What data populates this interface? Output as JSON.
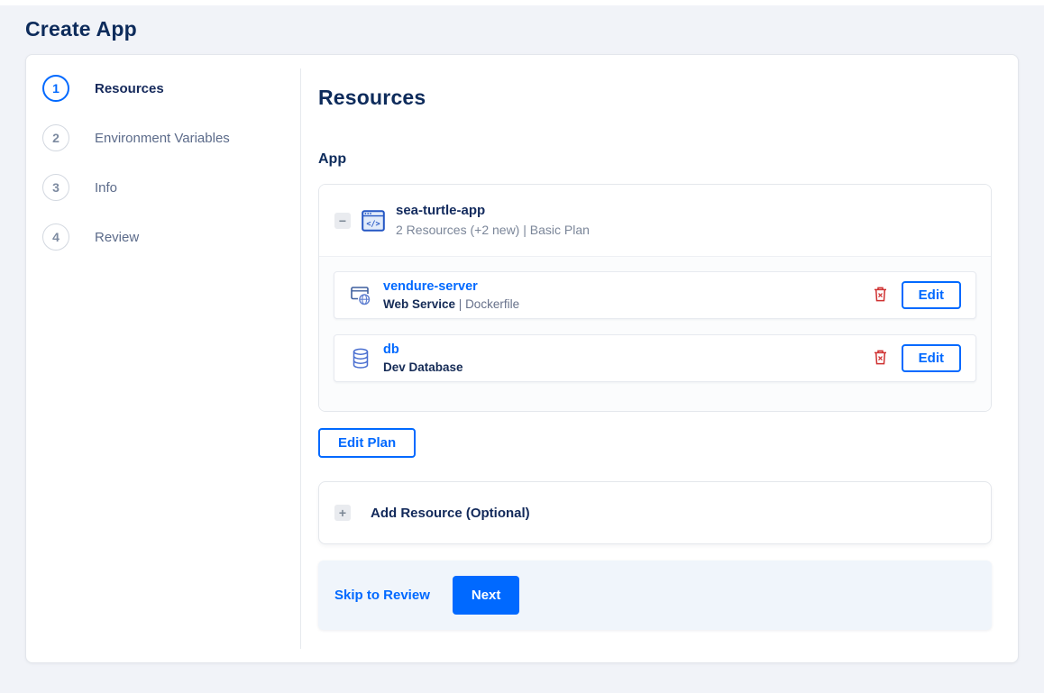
{
  "window": {
    "title": "Create App"
  },
  "stepper": {
    "steps": [
      {
        "number": "1",
        "label": "Resources",
        "state": "active"
      },
      {
        "number": "2",
        "label": "Environment Variables",
        "state": "upcoming"
      },
      {
        "number": "3",
        "label": "Info",
        "state": "upcoming"
      },
      {
        "number": "4",
        "label": "Review",
        "state": "upcoming"
      }
    ]
  },
  "main": {
    "heading": "Resources",
    "section_label": "App",
    "app_card": {
      "collapse_icon": "minus-icon",
      "collapse_glyph": "−",
      "app_icon": "code-window-icon",
      "name": "sea-turtle-app",
      "meta": "2 Resources (+2 new) | Basic Plan",
      "resources": [
        {
          "icon": "web-service-icon",
          "name": "vendure-server",
          "type": "Web Service",
          "separator": " | ",
          "detail": "Dockerfile",
          "delete_icon": "trash-icon",
          "edit_label": "Edit"
        },
        {
          "icon": "database-icon",
          "name": "db",
          "type": "Dev Database",
          "separator": "",
          "detail": "",
          "delete_icon": "trash-icon",
          "edit_label": "Edit"
        }
      ]
    },
    "edit_plan_label": "Edit Plan",
    "add_resource": {
      "icon": "plus-icon",
      "glyph": "+",
      "label": "Add Resource (Optional)"
    },
    "footer": {
      "skip_label": "Skip to Review",
      "next_label": "Next"
    }
  },
  "colors": {
    "accent": "#0069ff",
    "navy": "#0d2b5b",
    "muted_text": "#7b8699",
    "danger": "#cf3131",
    "page_bg": "#f1f3f8",
    "footer_bg": "#f0f5fb"
  }
}
